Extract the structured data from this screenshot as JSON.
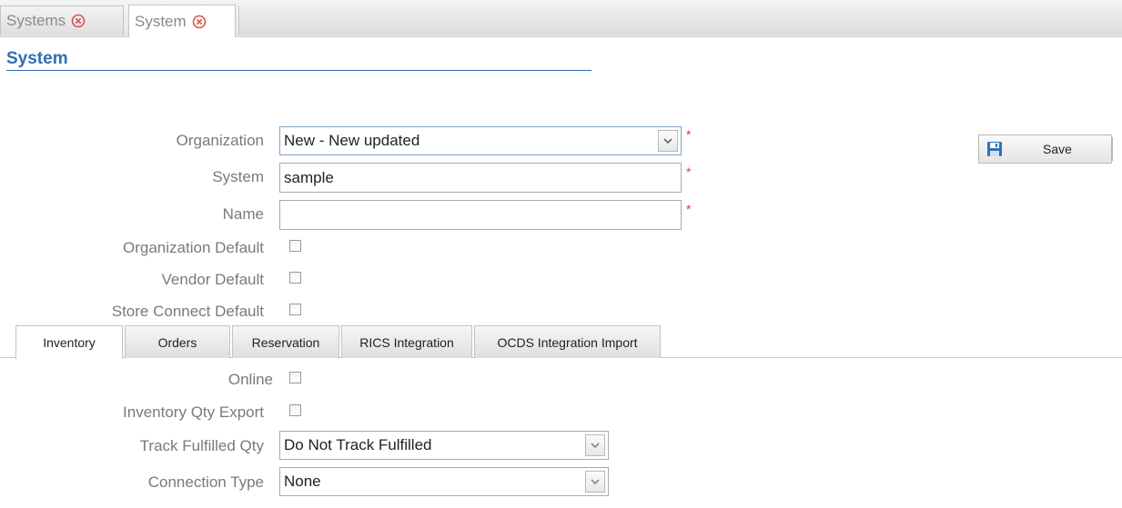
{
  "window_tabs": [
    {
      "label": "Systems",
      "close_icon": "close-circle-icon"
    },
    {
      "label": "System",
      "close_icon": "close-circle-icon"
    }
  ],
  "page_title": "System",
  "form": {
    "organization": {
      "label": "Organization",
      "value": "New - New updated"
    },
    "system": {
      "label": "System",
      "value": "sample"
    },
    "name": {
      "label": "Name",
      "value": ""
    },
    "organization_default": {
      "label": "Organization Default",
      "checked": false
    },
    "vendor_default": {
      "label": "Vendor Default",
      "checked": false
    },
    "store_connect_default": {
      "label": "Store Connect Default",
      "checked": false
    },
    "required_marker": "*"
  },
  "toolbar": {
    "save_label": "Save",
    "save_icon": "floppy-disk-icon"
  },
  "inner_tabs": [
    "Inventory",
    "Orders",
    "Reservation",
    "RICS Integration",
    "OCDS Integration Import"
  ],
  "inventory": {
    "online": {
      "label": "Online",
      "checked": false
    },
    "qty_export": {
      "label": "Inventory Qty Export",
      "checked": false
    },
    "track_fulfilled": {
      "label": "Track Fulfilled Qty",
      "value": "Do Not Track Fulfilled"
    },
    "connection_type": {
      "label": "Connection Type",
      "value": "None"
    }
  },
  "colors": {
    "accent": "#2f6fb2",
    "required": "#d04040",
    "close_icon": "#d9534f"
  }
}
